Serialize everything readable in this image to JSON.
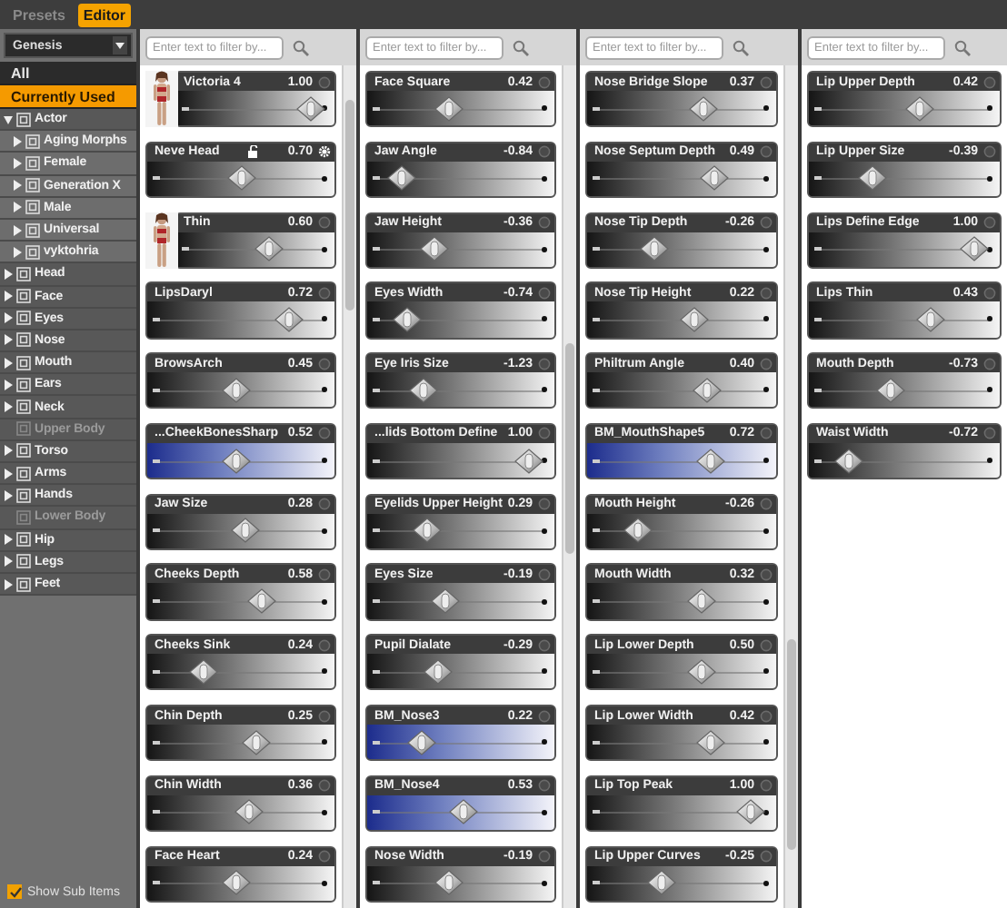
{
  "tabs": [
    {
      "label": "Presets",
      "selected": false
    },
    {
      "label": "Editor",
      "selected": true
    }
  ],
  "sidebar": {
    "dropdown": "Genesis",
    "filters": [
      {
        "label": "All",
        "selected": false
      },
      {
        "label": "Currently Used",
        "selected": true
      }
    ],
    "tree": [
      {
        "label": "Actor",
        "expandable": true,
        "expanded": true,
        "disabled": false,
        "children": [
          {
            "label": "Aging Morphs",
            "expandable": true,
            "expanded": false,
            "disabled": false
          },
          {
            "label": "Female",
            "expandable": true,
            "expanded": false,
            "disabled": false
          },
          {
            "label": "Generation X",
            "expandable": true,
            "expanded": false,
            "disabled": false
          },
          {
            "label": "Male",
            "expandable": true,
            "expanded": false,
            "disabled": false
          },
          {
            "label": "Universal",
            "expandable": true,
            "expanded": false,
            "disabled": false
          },
          {
            "label": "vyktohria",
            "expandable": true,
            "expanded": false,
            "disabled": false
          }
        ]
      },
      {
        "label": "Head",
        "expandable": true,
        "expanded": false,
        "disabled": false
      },
      {
        "label": "Face",
        "expandable": true,
        "expanded": false,
        "disabled": false
      },
      {
        "label": "Eyes",
        "expandable": true,
        "expanded": false,
        "disabled": false
      },
      {
        "label": "Nose",
        "expandable": true,
        "expanded": false,
        "disabled": false
      },
      {
        "label": "Mouth",
        "expandable": true,
        "expanded": false,
        "disabled": false
      },
      {
        "label": "Ears",
        "expandable": true,
        "expanded": false,
        "disabled": false
      },
      {
        "label": "Neck",
        "expandable": true,
        "expanded": false,
        "disabled": false
      },
      {
        "label": "Upper Body",
        "expandable": false,
        "expanded": false,
        "disabled": true
      },
      {
        "label": "Torso",
        "expandable": true,
        "expanded": false,
        "disabled": false
      },
      {
        "label": "Arms",
        "expandable": true,
        "expanded": false,
        "disabled": false
      },
      {
        "label": "Hands",
        "expandable": true,
        "expanded": false,
        "disabled": false
      },
      {
        "label": "Lower Body",
        "expandable": false,
        "expanded": false,
        "disabled": true
      },
      {
        "label": "Hip",
        "expandable": true,
        "expanded": false,
        "disabled": false
      },
      {
        "label": "Legs",
        "expandable": true,
        "expanded": false,
        "disabled": false
      },
      {
        "label": "Feet",
        "expandable": true,
        "expanded": false,
        "disabled": false
      }
    ],
    "show_sub_items": {
      "label": "Show Sub Items",
      "checked": true
    }
  },
  "columns": [
    {
      "search": {
        "placeholder": "Enter text to filter by..."
      },
      "sliders": [
        {
          "name": "Victoria 4",
          "value": "1.00",
          "level": 0.93,
          "kind": "figure",
          "highlighted": false
        },
        {
          "name": "Neve Head",
          "value": "0.70",
          "level": 0.5,
          "kind": "locked",
          "highlighted": false
        },
        {
          "name": "Thin",
          "value": "0.60",
          "level": 0.6,
          "kind": "figure",
          "highlighted": false
        },
        {
          "name": "LipsDaryl",
          "value": "0.72",
          "level": 0.8,
          "kind": "plain",
          "highlighted": false
        },
        {
          "name": "BrowsArch",
          "value": "0.45",
          "level": 0.47,
          "kind": "plain",
          "highlighted": false
        },
        {
          "name": "...CheekBonesSharp",
          "value": "0.52",
          "level": 0.47,
          "kind": "plain",
          "highlighted": true
        },
        {
          "name": "Jaw Size",
          "value": "0.28",
          "level": 0.53,
          "kind": "plain",
          "highlighted": false
        },
        {
          "name": "Cheeks Depth",
          "value": "0.58",
          "level": 0.63,
          "kind": "plain",
          "highlighted": false
        },
        {
          "name": "Cheeks Sink",
          "value": "0.24",
          "level": 0.26,
          "kind": "plain",
          "highlighted": false
        },
        {
          "name": "Chin Depth",
          "value": "0.25",
          "level": 0.6,
          "kind": "plain",
          "highlighted": false
        },
        {
          "name": "Chin Width",
          "value": "0.36",
          "level": 0.55,
          "kind": "plain",
          "highlighted": false
        },
        {
          "name": "Face Heart",
          "value": "0.24",
          "level": 0.47,
          "kind": "plain",
          "highlighted": false
        }
      ]
    },
    {
      "search": {
        "placeholder": "Enter text to filter by..."
      },
      "sliders": [
        {
          "name": "Face Square",
          "value": "0.42",
          "level": 0.42,
          "kind": "plain",
          "highlighted": false
        },
        {
          "name": "Jaw Angle",
          "value": "-0.84",
          "level": 0.13,
          "kind": "plain",
          "highlighted": false
        },
        {
          "name": "Jaw Height",
          "value": "-0.36",
          "level": 0.33,
          "kind": "plain",
          "highlighted": false
        },
        {
          "name": "Eyes Width",
          "value": "-0.74",
          "level": 0.16,
          "kind": "plain",
          "highlighted": false
        },
        {
          "name": "Eye Iris Size",
          "value": "-1.23",
          "level": 0.27,
          "kind": "plain",
          "highlighted": false
        },
        {
          "name": "...lids Bottom Define",
          "value": "1.00",
          "level": 0.93,
          "kind": "plain",
          "highlighted": false
        },
        {
          "name": "Eyelids Upper Height",
          "value": "0.29",
          "level": 0.29,
          "kind": "plain",
          "highlighted": false
        },
        {
          "name": "Eyes Size",
          "value": "-0.19",
          "level": 0.4,
          "kind": "plain",
          "highlighted": false
        },
        {
          "name": "Pupil Dialate",
          "value": "-0.29",
          "level": 0.36,
          "kind": "plain",
          "highlighted": false
        },
        {
          "name": "BM_Nose3",
          "value": "0.22",
          "level": 0.25,
          "kind": "plain",
          "highlighted": true
        },
        {
          "name": "BM_Nose4",
          "value": "0.53",
          "level": 0.52,
          "kind": "plain",
          "highlighted": true
        },
        {
          "name": "Nose Width",
          "value": "-0.19",
          "level": 0.42,
          "kind": "plain",
          "highlighted": false
        }
      ]
    },
    {
      "search": {
        "placeholder": "Enter text to filter by..."
      },
      "sliders": [
        {
          "name": "Nose Bridge Slope",
          "value": "0.37",
          "level": 0.64,
          "kind": "plain",
          "highlighted": false
        },
        {
          "name": "Nose Septum Depth",
          "value": "0.49",
          "level": 0.7,
          "kind": "plain",
          "highlighted": false
        },
        {
          "name": "Nose Tip Depth",
          "value": "-0.26",
          "level": 0.33,
          "kind": "plain",
          "highlighted": false
        },
        {
          "name": "Nose Tip Height",
          "value": "0.22",
          "level": 0.58,
          "kind": "plain",
          "highlighted": false
        },
        {
          "name": "Philtrum Angle",
          "value": "0.40",
          "level": 0.66,
          "kind": "plain",
          "highlighted": false
        },
        {
          "name": "BM_MouthShape5",
          "value": "0.72",
          "level": 0.68,
          "kind": "plain",
          "highlighted": true
        },
        {
          "name": "Mouth Height",
          "value": "-0.26",
          "level": 0.23,
          "kind": "plain",
          "highlighted": false
        },
        {
          "name": "Mouth Width",
          "value": "0.32",
          "level": 0.62,
          "kind": "plain",
          "highlighted": false
        },
        {
          "name": "Lip Lower Depth",
          "value": "0.50",
          "level": 0.63,
          "kind": "plain",
          "highlighted": false
        },
        {
          "name": "Lip Lower Width",
          "value": "0.42",
          "level": 0.68,
          "kind": "plain",
          "highlighted": false
        },
        {
          "name": "Lip Top Peak",
          "value": "1.00",
          "level": 0.93,
          "kind": "plain",
          "highlighted": false
        },
        {
          "name": "Lip Upper Curves",
          "value": "-0.25",
          "level": 0.38,
          "kind": "plain",
          "highlighted": false
        }
      ]
    },
    {
      "search": {
        "placeholder": "Enter text to filter by..."
      },
      "sliders": [
        {
          "name": "Lip Upper Depth",
          "value": "0.42",
          "level": 0.6,
          "kind": "plain",
          "highlighted": false
        },
        {
          "name": "Lip Upper Size",
          "value": "-0.39",
          "level": 0.3,
          "kind": "plain",
          "highlighted": false
        },
        {
          "name": "Lips Define Edge",
          "value": "1.00",
          "level": 0.93,
          "kind": "plain",
          "highlighted": false
        },
        {
          "name": "Lips Thin",
          "value": "0.43",
          "level": 0.66,
          "kind": "plain",
          "highlighted": false
        },
        {
          "name": "Mouth Depth",
          "value": "-0.73",
          "level": 0.42,
          "kind": "plain",
          "highlighted": false
        },
        {
          "name": "Waist Width",
          "value": "-0.72",
          "level": 0.16,
          "kind": "plain",
          "highlighted": false
        }
      ]
    }
  ]
}
